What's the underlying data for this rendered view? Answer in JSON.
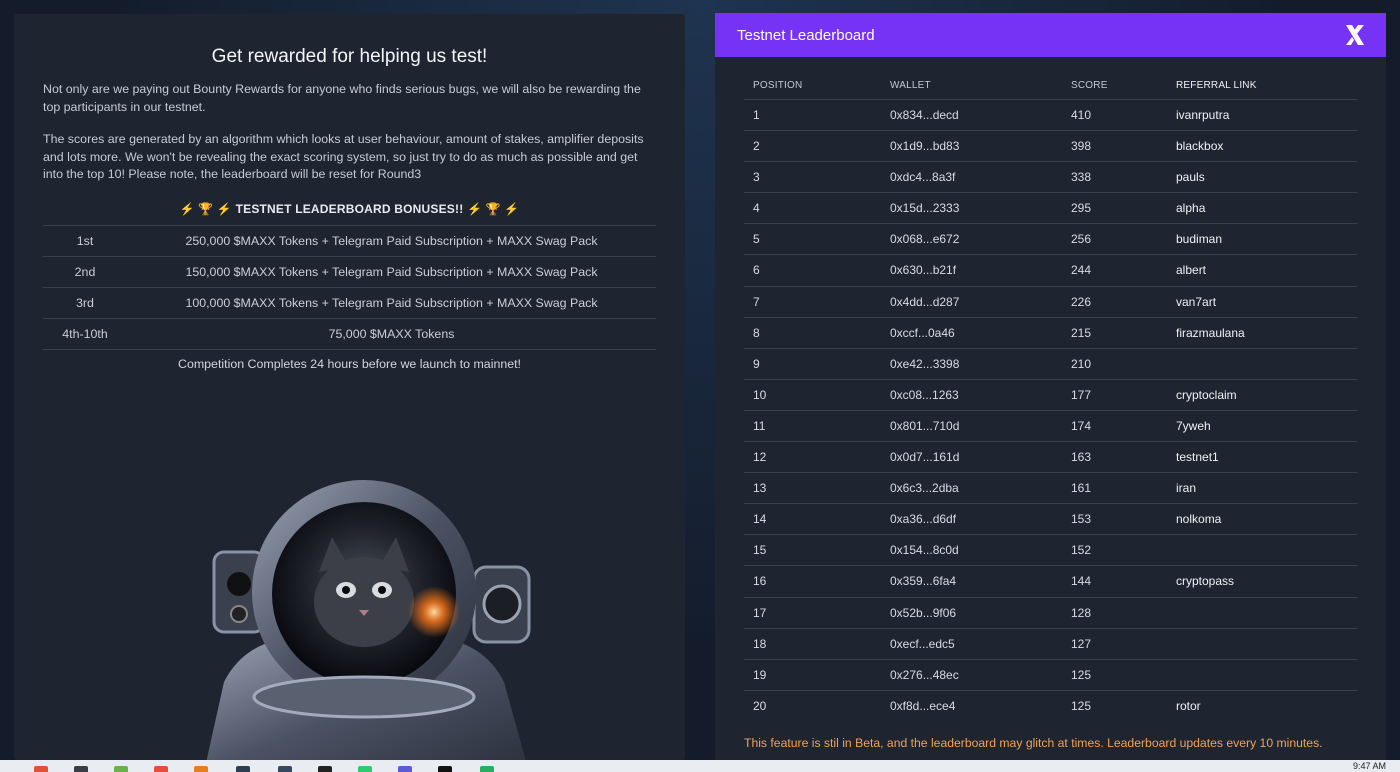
{
  "left": {
    "title": "Get rewarded for helping us test!",
    "paragraph1": "Not only are we paying out Bounty Rewards for anyone who finds serious bugs, we will also be rewarding the top participants in our testnet.",
    "paragraph2": "The scores are generated by an algorithm which looks at user behaviour, amount of stakes, amplifier deposits and lots more. We won't be revealing the exact scoring system, so just try to do as much as possible and get into the top 10! Please note, the leaderboard will be reset for Round3",
    "bonus_heading_prefix": "⚡ 🏆 ⚡",
    "bonus_heading": "TESTNET LEADERBOARD BONUSES!!",
    "bonus_heading_suffix": "⚡ 🏆 ⚡",
    "bonuses": [
      {
        "place": "1st",
        "prize": "250,000 $MAXX Tokens + Telegram Paid Subscription + MAXX Swag Pack"
      },
      {
        "place": "2nd",
        "prize": "150,000 $MAXX Tokens + Telegram Paid Subscription + MAXX Swag Pack"
      },
      {
        "place": "3rd",
        "prize": "100,000 $MAXX Tokens + Telegram Paid Subscription + MAXX Swag Pack"
      },
      {
        "place": "4th-10th",
        "prize": "75,000 $MAXX Tokens"
      }
    ],
    "completion_note": "Competition Completes 24 hours before we launch to mainnet!"
  },
  "leaderboard": {
    "title": "Testnet Leaderboard",
    "headers": {
      "position": "POSITION",
      "wallet": "WALLET",
      "score": "SCORE",
      "referral": "REFERRAL LINK"
    },
    "rows": [
      {
        "position": "1",
        "wallet": "0x834...decd",
        "score": "410",
        "referral": "ivanrputra"
      },
      {
        "position": "2",
        "wallet": "0x1d9...bd83",
        "score": "398",
        "referral": "blackbox"
      },
      {
        "position": "3",
        "wallet": "0xdc4...8a3f",
        "score": "338",
        "referral": "pauls"
      },
      {
        "position": "4",
        "wallet": "0x15d...2333",
        "score": "295",
        "referral": "alpha"
      },
      {
        "position": "5",
        "wallet": "0x068...e672",
        "score": "256",
        "referral": "budiman"
      },
      {
        "position": "6",
        "wallet": "0x630...b21f",
        "score": "244",
        "referral": "albert"
      },
      {
        "position": "7",
        "wallet": "0x4dd...d287",
        "score": "226",
        "referral": "van7art"
      },
      {
        "position": "8",
        "wallet": "0xccf...0a46",
        "score": "215",
        "referral": "firazmaulana"
      },
      {
        "position": "9",
        "wallet": "0xe42...3398",
        "score": "210",
        "referral": ""
      },
      {
        "position": "10",
        "wallet": "0xc08...1263",
        "score": "177",
        "referral": "cryptoclaim"
      },
      {
        "position": "11",
        "wallet": "0x801...710d",
        "score": "174",
        "referral": "7yweh"
      },
      {
        "position": "12",
        "wallet": "0x0d7...161d",
        "score": "163",
        "referral": "testnet1"
      },
      {
        "position": "13",
        "wallet": "0x6c3...2dba",
        "score": "161",
        "referral": "iran"
      },
      {
        "position": "14",
        "wallet": "0xa36...d6df",
        "score": "153",
        "referral": "nolkoma"
      },
      {
        "position": "15",
        "wallet": "0x154...8c0d",
        "score": "152",
        "referral": ""
      },
      {
        "position": "16",
        "wallet": "0x359...6fa4",
        "score": "144",
        "referral": "cryptopass"
      },
      {
        "position": "17",
        "wallet": "0x52b...9f06",
        "score": "128",
        "referral": ""
      },
      {
        "position": "18",
        "wallet": "0xecf...edc5",
        "score": "127",
        "referral": ""
      },
      {
        "position": "19",
        "wallet": "0x276...48ec",
        "score": "125",
        "referral": ""
      },
      {
        "position": "20",
        "wallet": "0xf8d...ece4",
        "score": "125",
        "referral": "rotor"
      }
    ],
    "beta_note": "This feature is stil in Beta, and the leaderboard may glitch at times. Leaderboard updates every 10 minutes."
  },
  "taskbar": {
    "time": "9:47 AM"
  },
  "colors": {
    "header_purple": "#7633f5",
    "panel_bg": "#1f2530",
    "beta_orange": "#f0a254"
  },
  "icons": {
    "close": "x-logo-icon",
    "astronaut": "cat-astronaut-image"
  }
}
